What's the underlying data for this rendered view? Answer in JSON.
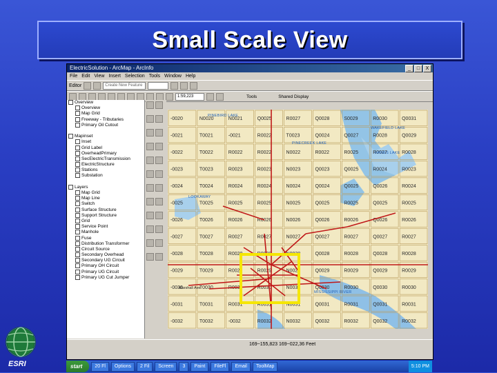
{
  "slide": {
    "title": "Small Scale View"
  },
  "window": {
    "title": "ElectricSolution - ArcMap - ArcInfo",
    "controls": [
      "_",
      "□",
      "X"
    ]
  },
  "menu": [
    "File",
    "Edit",
    "View",
    "Insert",
    "Selection",
    "Tools",
    "Window",
    "Help"
  ],
  "editor_toolbar": {
    "editor_label": "Editor",
    "task_value": "Create New Feature",
    "target_value": ""
  },
  "standard_toolbar": {
    "scale_value": "1:59,223",
    "layer_label": "Tools",
    "display_label": "Shared Display"
  },
  "toc": {
    "rows": [
      "Overview",
      "Overview",
      "Map Grid",
      "Freeway - Tributaries",
      "Primary Oil Cutout",
      "",
      "Mapinset",
      "Inset",
      "Grid Label",
      "OverheadPrimary",
      "SecElectricTransmission",
      "ElectricStructure",
      "Stations",
      "Substation",
      "",
      "Layers",
      "Map Grid",
      "Map Line",
      "Switch",
      "Surface Structure",
      "Support Structure",
      "Grid",
      "Service Point",
      "Manhole",
      "Fuse",
      "Distribution Transformer",
      "Circuit Source",
      "Secondary Overhead",
      "Secondary UG Circuit",
      "Primary OH Circuit",
      "Primary UG Circuit",
      "Primary UG Cut Jumper"
    ]
  },
  "map": {
    "row_labels": [
      [
        "-0020",
        "N0020",
        "N0021",
        "Q0025",
        "R0027",
        "Q0028",
        "S0029",
        "R0030",
        "Q0031"
      ],
      [
        "-0021",
        "T0021",
        "-0021",
        "R0022",
        "T0023",
        "Q0024",
        "Q0027",
        "R0028",
        "Q0029"
      ],
      [
        "-0022",
        "T0022",
        "R0022",
        "R0022",
        "N0022",
        "R0022",
        "R0025",
        "R0027",
        "R0028"
      ],
      [
        "-0023",
        "T0023",
        "R0023",
        "R0023",
        "N0023",
        "Q0023",
        "Q0025",
        "R0024",
        "R0023"
      ],
      [
        "-0024",
        "T0024",
        "R0024",
        "R0024",
        "N0024",
        "Q0024",
        "Q0025",
        "Q0026",
        "R0024"
      ],
      [
        "-0025",
        "T0025",
        "R0025",
        "R0025",
        "N0025",
        "Q0025",
        "R0025",
        "Q0025",
        "R0025"
      ],
      [
        "-0026",
        "T0026",
        "R0026",
        "R0026",
        "N0026",
        "Q0026",
        "R0026",
        "Q0026",
        "R0026"
      ],
      [
        "-0027",
        "T0027",
        "R0027",
        "R0027",
        "N0027",
        "Q0027",
        "R0027",
        "Q0027",
        "R0027"
      ],
      [
        "-0028",
        "T0028",
        "R0028",
        "R0028",
        "N0028",
        "Q0028",
        "R0028",
        "Q0028",
        "R0028"
      ],
      [
        "-0029",
        "T0029",
        "R0029",
        "R0029",
        "N0029",
        "Q0029",
        "R0029",
        "Q0029",
        "R0029"
      ],
      [
        "-0030",
        "T0030",
        "R0030",
        "R0030",
        "N0030",
        "Q0030",
        "R0030",
        "Q0030",
        "R0030"
      ],
      [
        "-0031",
        "T0031",
        "R0031",
        "R0031",
        "N0031",
        "Q0031",
        "R0031",
        "Q0031",
        "R0031"
      ],
      [
        "-0032",
        "T0032",
        "-0032",
        "R0032",
        "N0032",
        "Q0032",
        "R0032",
        "Q0032",
        "R0032"
      ]
    ],
    "lake_labels": [
      "PINEBIRD LAKE",
      "WAKEFIELD LAKE",
      "PINECREEK LAKE",
      "HANES LAKE",
      "LOOKAWAY",
      "MISSISSIPPI RIVER"
    ],
    "street_label": "Marshall Ave",
    "highlight_color": "#f5e600"
  },
  "status": {
    "coords": "169~155,823  169~022,36 Feet"
  },
  "taskbar": {
    "start": "start",
    "tasks": [
      "20 Fl",
      "Options",
      "2 Fil",
      "Screen",
      "3",
      "Paint",
      "FileFl",
      "Email",
      "ToolMap"
    ],
    "time": "5:10 PM"
  },
  "branding": {
    "logo_text": "ESRI"
  }
}
